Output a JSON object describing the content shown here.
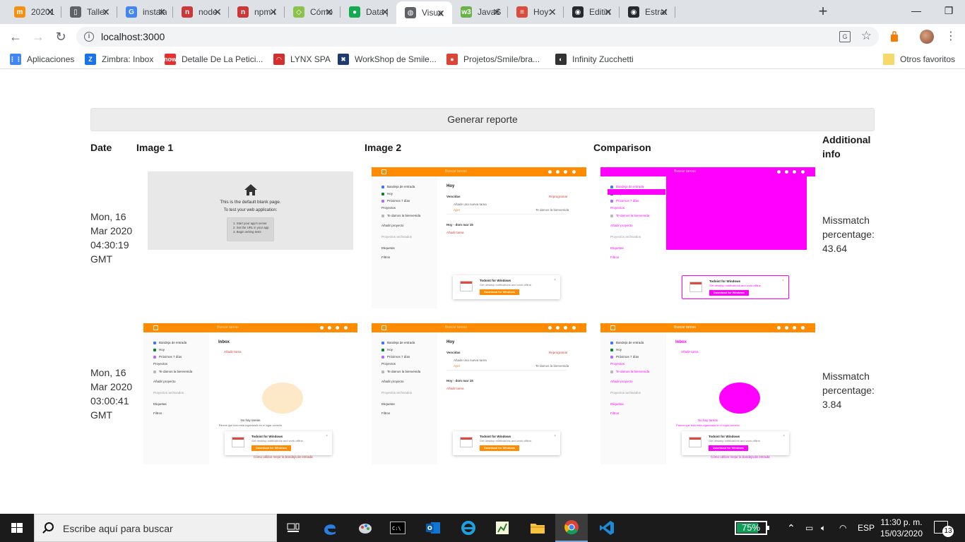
{
  "browser": {
    "tabs": [
      {
        "label": "20201",
        "color": "#f29111",
        "glyph": "m"
      },
      {
        "label": "Taller",
        "color": "#5f6368",
        "glyph": "▯"
      },
      {
        "label": "instala",
        "color": "#4285f4",
        "glyph": "G"
      },
      {
        "label": "node-",
        "color": "#cb3837",
        "glyph": "n"
      },
      {
        "label": "npm-i",
        "color": "#cb3837",
        "glyph": "n"
      },
      {
        "label": "Cómo",
        "color": "#8bc34a",
        "glyph": "◇"
      },
      {
        "label": "Data |",
        "color": "#13aa52",
        "glyph": "●"
      },
      {
        "label": "Visua",
        "color": "#5f6368",
        "glyph": "◍"
      },
      {
        "label": "JavaS",
        "color": "#67b346",
        "glyph": "w3"
      },
      {
        "label": "Hoy:",
        "color": "#db4c3f",
        "glyph": "≡"
      },
      {
        "label": "Editin",
        "color": "#24292e",
        "glyph": "◉"
      },
      {
        "label": "Estrat",
        "color": "#24292e",
        "glyph": "◉"
      }
    ],
    "url": "localhost:3000",
    "bookmarks": [
      {
        "label": "Aplicaciones",
        "color": "#4285f4",
        "glyph": "⋮⋮"
      },
      {
        "label": "Zimbra: Inbox",
        "color": "#1a73e8",
        "glyph": "Z"
      },
      {
        "label": "Detalle De La Petici...",
        "color": "#e62e2e",
        "glyph": "now"
      },
      {
        "label": "LYNX SPA",
        "color": "#d32f2f",
        "glyph": "◠"
      },
      {
        "label": "WorkShop de Smile...",
        "color": "#1e3a6e",
        "glyph": "✖"
      },
      {
        "label": "Projetos/Smile/bra...",
        "color": "#db4437",
        "glyph": "●"
      },
      {
        "label": "Infinity Zucchetti",
        "color": "#333333",
        "glyph": "◐"
      }
    ],
    "other_bookmarks": "Otros favoritos"
  },
  "page": {
    "report_button": "Generar reporte",
    "headers": {
      "date": "Date",
      "image1": "Image 1",
      "image2": "Image 2",
      "comparison": "Comparison",
      "info_line1": "Additional",
      "info_line2": "info"
    },
    "rows": [
      {
        "date_lines": [
          "Mon, 16",
          "Mar 2020",
          "04:30:19",
          "GMT"
        ],
        "info_lines": [
          "Missmatch",
          "percentage:",
          "43.64"
        ]
      },
      {
        "date_lines": [
          "Mon, 16",
          "Mar 2020",
          "03:00:41",
          "GMT"
        ],
        "info_lines": [
          "Missmatch",
          "percentage:",
          "3.84"
        ]
      }
    ],
    "blank_page": {
      "line1": "This is the default blank page.",
      "line2": "To test your web application:",
      "steps": [
        "1. Start your app's server",
        "2. Set the URL in your app",
        "3. Begin writing tests"
      ]
    },
    "todoist": {
      "search": "Buscar tareas",
      "nav": [
        "Bandeja de entrada",
        "Hoy",
        "Próximos 7 días",
        "Proyectos",
        "Te damos la bienvenida",
        "Añadir proyecto",
        "Proyectos archivados",
        "Etiquetas",
        "Filtros"
      ],
      "today_title": "Hoy",
      "overdue": "Vencidas",
      "reschedule": "Reprogramar",
      "task": "Añade una nueva tarea",
      "task_meta": "Ayer",
      "project_tag": "Te damos la bienvenida",
      "today_date": "Hoy · dom mar 15",
      "add_task": "Añadir tarea",
      "inbox_title": "Inbox",
      "no_tasks": "No hay tareas",
      "no_tasks_sub": "Parece que todo está organizado en el lugar correcto",
      "inbox_link": "Cómo utilizar mejor la bandeja de entrada",
      "popup_title": "Todoist for Windows",
      "popup_sub": "Get desktop notifications and work offline.",
      "popup_button": "Download for Windows"
    }
  },
  "taskbar": {
    "search_placeholder": "Escribe aquí para buscar",
    "battery": "75%",
    "battery_level": 0.75,
    "lang": "ESP",
    "time": "11:30 p. m.",
    "date": "15/03/2020",
    "notifications": "13"
  }
}
